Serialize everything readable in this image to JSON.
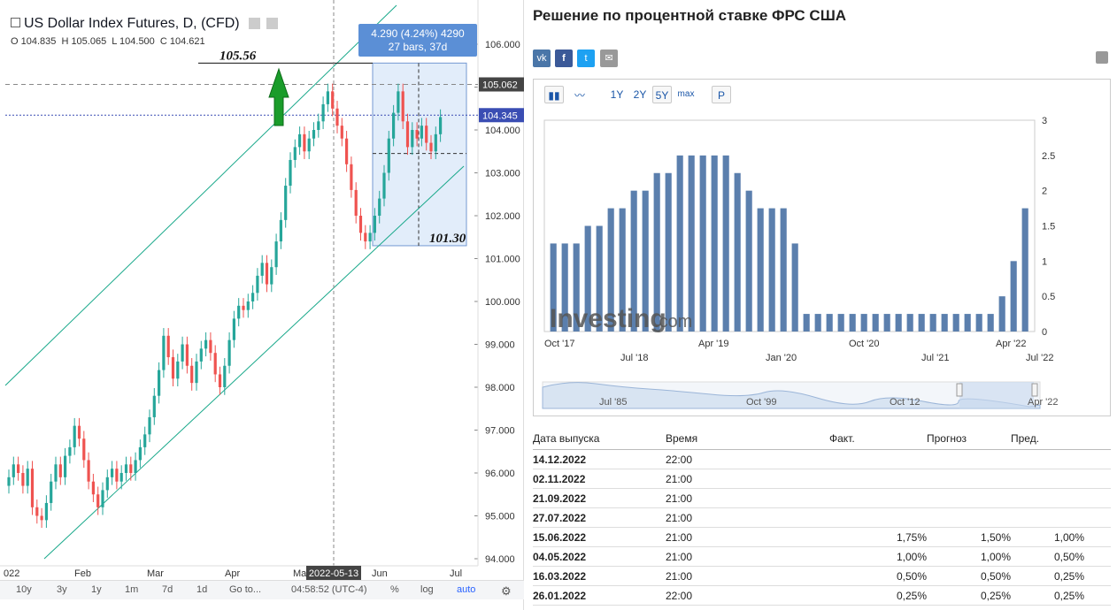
{
  "left_chart": {
    "title": "US Dollar Index Futures, D, (CFD)",
    "ohlc": {
      "o": "O 104.835",
      "h": "H 105.065",
      "l": "L 104.500",
      "c": "C 104.621"
    },
    "price_axis": [
      "106.000",
      "105.000",
      "104.000",
      "103.000",
      "102.000",
      "101.000",
      "100.000",
      "99.000",
      "98.000",
      "97.000",
      "96.000",
      "95.000",
      "94.000"
    ],
    "current_price": "104.345",
    "marker_price": "105.062",
    "range_tooltip": {
      "line1": "4.290 (4.24%) 4290",
      "line2": "27 bars, 37d"
    },
    "annotations": {
      "high": "105.56",
      "low": "101.30"
    },
    "time_axis": [
      "022",
      "Feb",
      "Mar",
      "Apr",
      "Ma",
      "Jun",
      "Jul"
    ],
    "date_marker": "2022-05-13",
    "bottom_bar": {
      "ranges": [
        "10y",
        "3y",
        "1y",
        "1m",
        "7d",
        "1d"
      ],
      "goto": "Go to...",
      "time": "04:58:52 (UTC-4)",
      "pct": "%",
      "log": "log",
      "auto": "auto"
    }
  },
  "right_panel": {
    "title": "Решение по процентной ставке ФРС США",
    "share": [
      "vk",
      "f",
      "twitter",
      "mail"
    ],
    "toolbar": {
      "y1": "1Y",
      "y2": "2Y",
      "y5": "5Y",
      "max": "max",
      "p": "P"
    },
    "watermark": {
      "brand": "Investing",
      "suffix": ".com"
    },
    "colors": {
      "bars": "#5b7fad",
      "accent": "#1a56a8",
      "green": "#0ea600"
    },
    "table": {
      "headers": {
        "date": "Дата выпуска",
        "time": "Время",
        "actual": "Факт.",
        "forecast": "Прогноз",
        "previous": "Пред."
      },
      "rows": [
        {
          "date": "14.12.2022",
          "time": "22:00",
          "actual": "",
          "forecast": "",
          "previous": ""
        },
        {
          "date": "02.11.2022",
          "time": "21:00",
          "actual": "",
          "forecast": "",
          "previous": ""
        },
        {
          "date": "21.09.2022",
          "time": "21:00",
          "actual": "",
          "forecast": "",
          "previous": ""
        },
        {
          "date": "27.07.2022",
          "time": "21:00",
          "actual": "",
          "forecast": "",
          "previous": ""
        },
        {
          "date": "15.06.2022",
          "time": "21:00",
          "actual": "1,75%",
          "forecast": "1,50%",
          "previous": "1,00%"
        },
        {
          "date": "04.05.2022",
          "time": "21:00",
          "actual": "1,00%",
          "forecast": "1,00%",
          "previous": "0,50%"
        },
        {
          "date": "16.03.2022",
          "time": "21:00",
          "actual": "0,50%",
          "forecast": "0,50%",
          "previous": "0,25%"
        },
        {
          "date": "26.01.2022",
          "time": "22:00",
          "actual": "0,25%",
          "forecast": "0,25%",
          "previous": "0,25%"
        }
      ]
    }
  },
  "chart_data": [
    {
      "type": "bar",
      "title": "",
      "ylim": [
        0,
        3
      ],
      "y_ticks": [
        "3",
        "2.5",
        "2",
        "1.5",
        "1",
        "0.5",
        "0"
      ],
      "x_labels_top": [
        "Oct '17",
        "Apr '19",
        "Oct '20",
        "Apr '22"
      ],
      "x_labels_bottom": [
        "Jul '18",
        "Jan '20",
        "Jul '21",
        "Jul '22"
      ],
      "values": [
        1.25,
        1.25,
        1.25,
        1.5,
        1.5,
        1.75,
        1.75,
        2.0,
        2.0,
        2.25,
        2.25,
        2.5,
        2.5,
        2.5,
        2.5,
        2.5,
        2.25,
        2.0,
        1.75,
        1.75,
        1.75,
        1.25,
        0.25,
        0.25,
        0.25,
        0.25,
        0.25,
        0.25,
        0.25,
        0.25,
        0.25,
        0.25,
        0.25,
        0.25,
        0.25,
        0.25,
        0.25,
        0.25,
        0.25,
        0.5,
        1.0,
        1.75
      ],
      "navigator_labels": [
        "Jul '85",
        "Oct '99",
        "Oct '12",
        "Apr '22"
      ]
    }
  ]
}
